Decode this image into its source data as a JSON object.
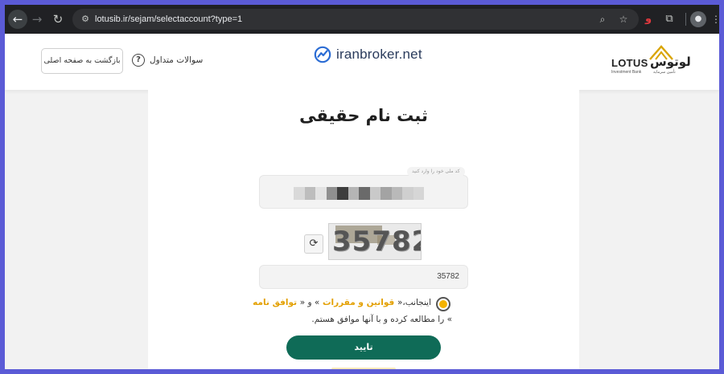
{
  "browser": {
    "url": "lotusib.ir/sejam/selectaccount?type=1",
    "icons": {
      "back": "arrow-left-icon",
      "forward": "arrow-right-icon",
      "reload": "reload-icon",
      "site_info": "tune-icon",
      "zoom": "zoom-icon",
      "bookmark": "star-icon",
      "extension_red": "extension-icon",
      "extensions": "puzzle-icon",
      "profile": "profile-icon",
      "menu": "more-vertical-icon"
    }
  },
  "header": {
    "back_home_label": "بازگشت به صفحه اصلی",
    "faq_label": "سوالات متداول",
    "faq_icon_glyph": "?",
    "watermark": "iranbroker.net",
    "logo": {
      "latin": "LOTUS",
      "persian": "لوتوس",
      "subtitle_en": "Investment Bank",
      "subtitle_fa": "تأمین سرمایه"
    }
  },
  "main": {
    "title": "ثبت نام حقیقی",
    "code_field": {
      "label": "کد ملی خود را وارد کنید"
    },
    "captcha": {
      "image_text": "35782",
      "input_value": "35782",
      "refresh_icon": "refresh-icon"
    },
    "terms": {
      "prefix": "اینجانب،«",
      "rules_link": " قوانین و مقررات ",
      "middle": "» و «",
      "agreement_link": " توافق نامه ",
      "suffix": "» را مطالعه کرده و با آنها موافق هستم."
    },
    "submit_label": "تایید"
  },
  "colors": {
    "primary": "#0f6b57",
    "accent": "#f5b301",
    "link": "#e3a000",
    "frame": "#5b5bd6"
  }
}
